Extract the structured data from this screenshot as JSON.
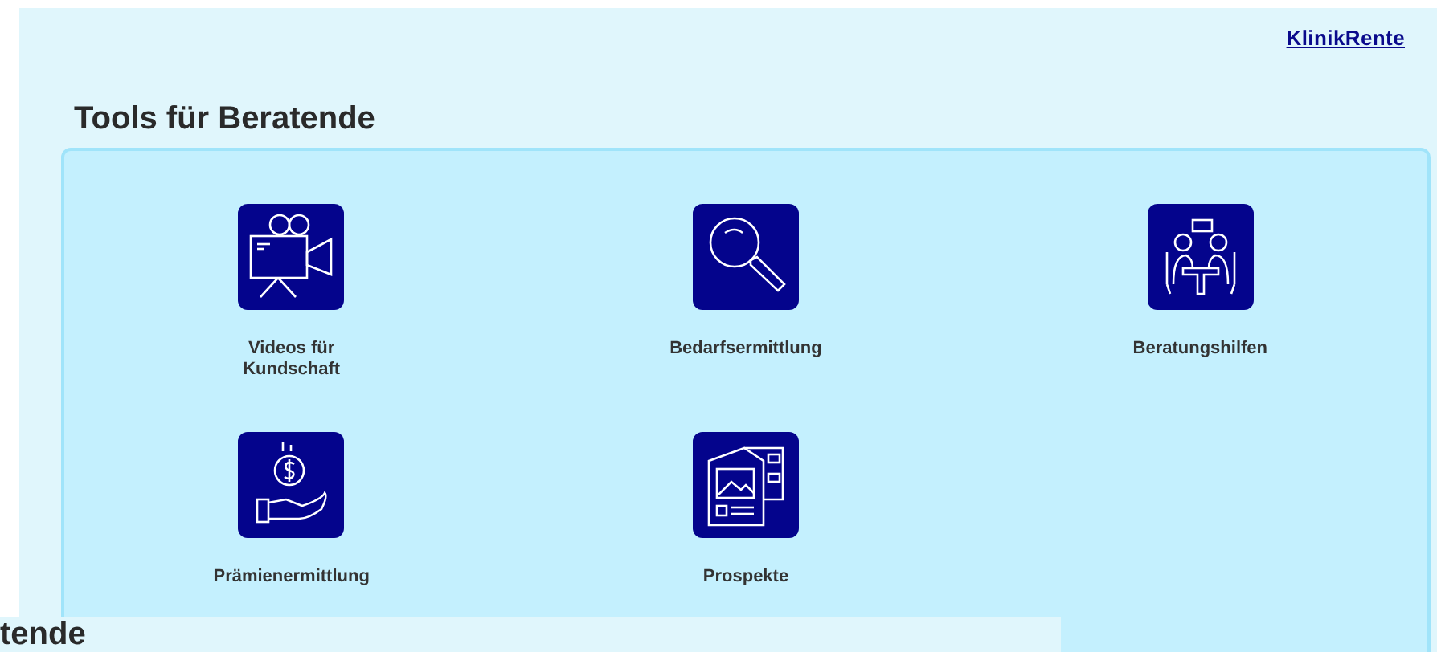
{
  "logo": "KlinikRente",
  "heading": "Tools für Beratende",
  "tools": [
    {
      "label": "Videos für Kundschaft",
      "kind": "video"
    },
    {
      "label": "Bedarfsermittlung",
      "kind": "search"
    },
    {
      "label": "Beratungshilfen",
      "kind": "meeting"
    },
    {
      "label": "Prämienermittlung",
      "kind": "money"
    },
    {
      "label": "Prospekte",
      "kind": "brochure"
    }
  ],
  "overlay_heading": "tende"
}
